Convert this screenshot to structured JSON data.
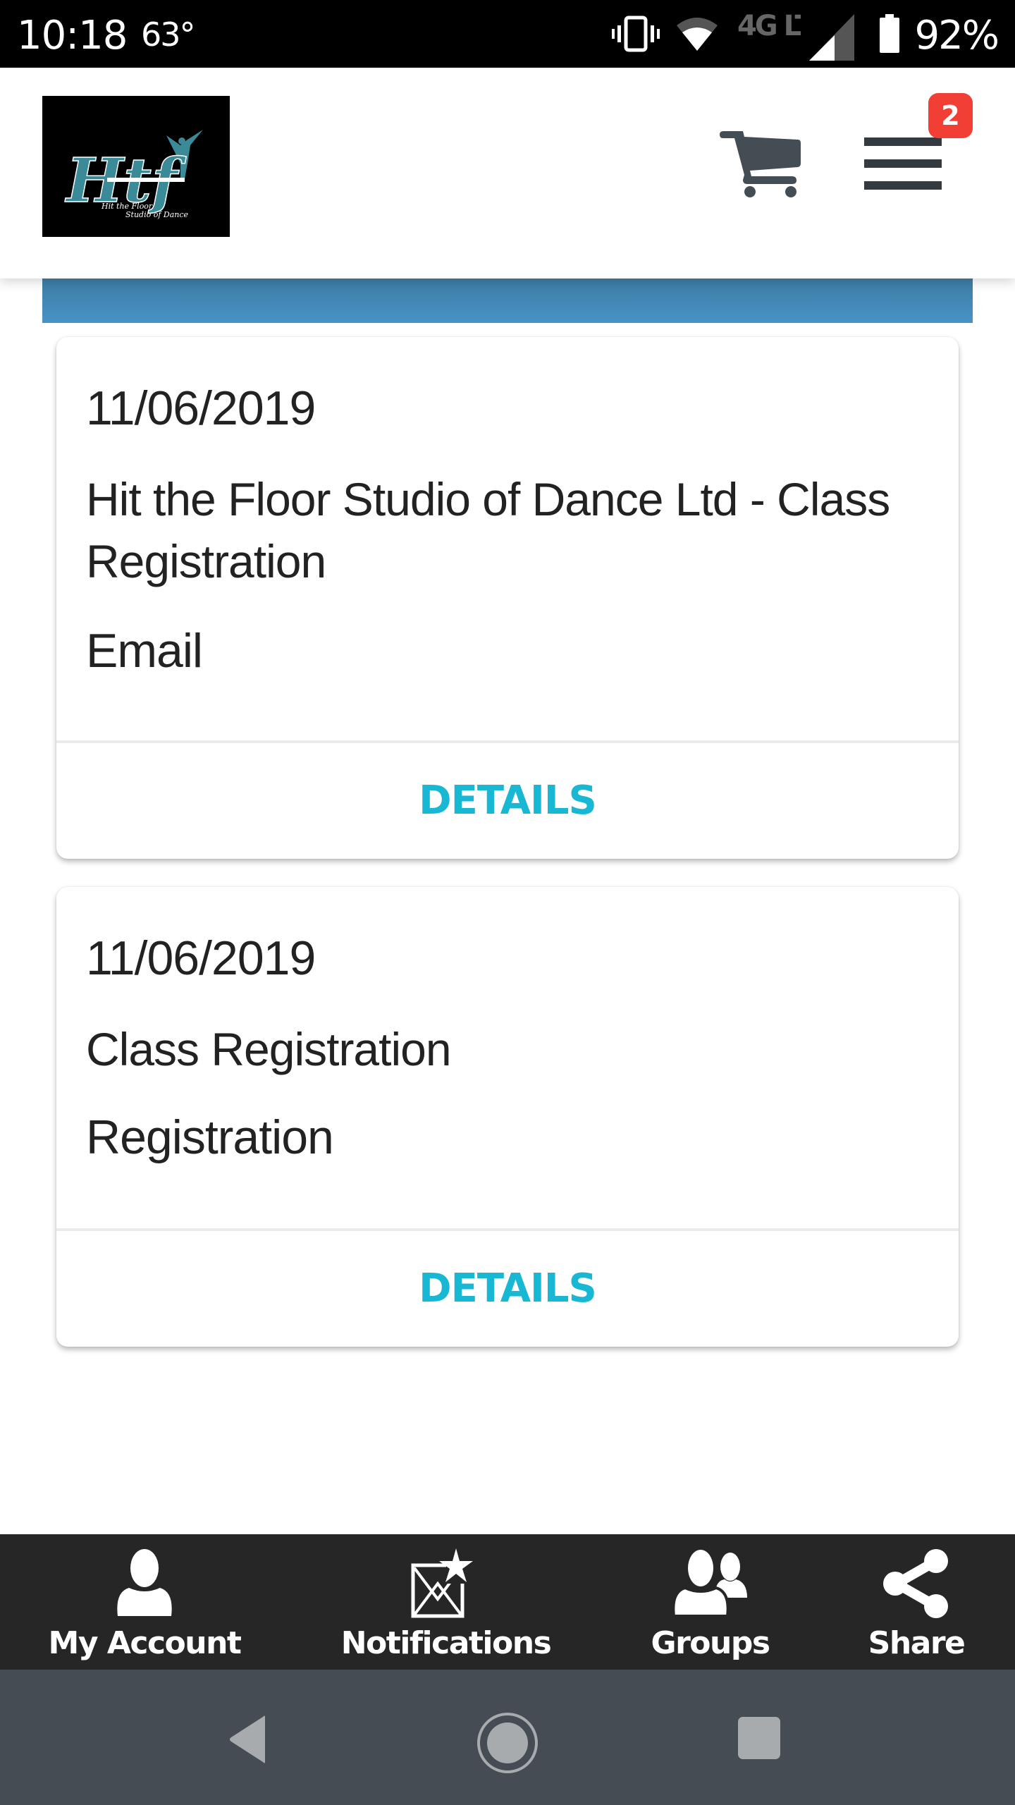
{
  "status_bar": {
    "time": "10:18",
    "temperature": "63°",
    "network": "4G LTE",
    "battery": "92%",
    "icons": [
      "vibrate-icon",
      "wifi-icon",
      "lte-icon",
      "signal-icon",
      "battery-icon"
    ]
  },
  "header": {
    "logo_alt": "Hit the Floor Studio of Dance",
    "logo_text": "Htf",
    "logo_subtitle_1": "Hit the Floor",
    "logo_subtitle_2": "Studio of Dance",
    "cart_icon": "cart-icon",
    "menu_icon": "hamburger-icon",
    "menu_badge": "2"
  },
  "colors": {
    "accent": "#18b8d4",
    "banner_blue": "#4793c6",
    "badge_red": "#f23f35",
    "bottom_nav_bg": "#262626",
    "system_nav_bg": "#454c53"
  },
  "cards": [
    {
      "date": "11/06/2019",
      "title": "Hit the Floor Studio of Dance Ltd - Class Registration",
      "type": "Email",
      "action_label": "DETAILS"
    },
    {
      "date": "11/06/2019",
      "title": "Class Registration",
      "type": "Registration",
      "action_label": "DETAILS"
    }
  ],
  "bottom_nav": {
    "items": [
      {
        "label": "My Account",
        "icon": "user-icon"
      },
      {
        "label": "Notifications",
        "icon": "envelope-star-icon"
      },
      {
        "label": "Groups",
        "icon": "users-icon"
      },
      {
        "label": "Share",
        "icon": "share-icon"
      }
    ]
  },
  "system_nav": {
    "back": "back-icon",
    "home": "home-icon",
    "recents": "recents-icon"
  }
}
